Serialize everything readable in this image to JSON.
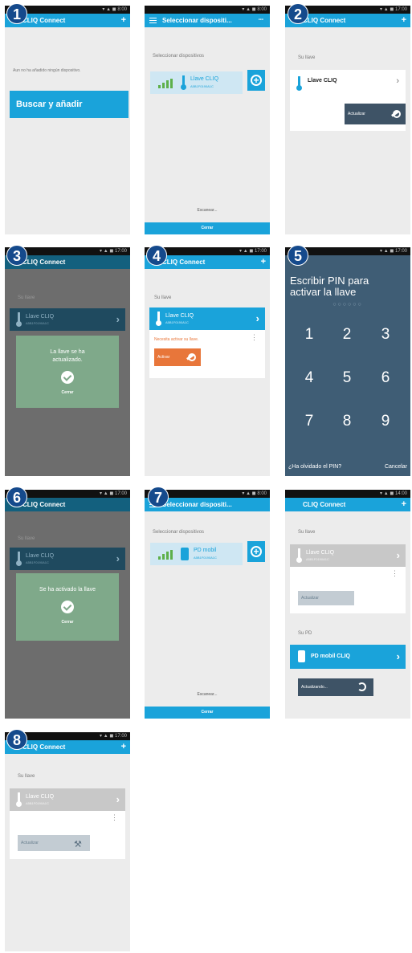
{
  "badges": [
    "1",
    "2",
    "3",
    "4",
    "5",
    "6",
    "7",
    "8"
  ],
  "colors": {
    "accent": "#1aa3da",
    "badge": "#154a8c",
    "dialog": "#7fa98a",
    "orange": "#e8763a",
    "pin_bg": "#3f5d75"
  },
  "app_title": "CLIQ Connect",
  "select_title": "Seleccionar dispositi...",
  "select_subtitle": "Seleccionar dispositivos",
  "add_prompt": "Aun no ha añadido ningún dispositivo.",
  "search_add": "Buscar y añadir",
  "device_key_name": "Llave CLIQ",
  "device_key_id": "A5B1F0190A1C",
  "scanning": "Escanear...",
  "close_short": "Cerrar",
  "your_key": "Su llave",
  "key_name": "Llave CLIQ",
  "key_id": "A5B1F0190A1C",
  "update_btn": "Actualizar",
  "updated_msg": "La llave se ha actualizado.",
  "need_activate": "Necesita activar su llave.",
  "activate_btn": "Activar",
  "pin_title": "Escribir PIN para activar la llave",
  "pin_dots": "○○○○○○",
  "pin_digits": [
    "1",
    "2",
    "3",
    "4",
    "5",
    "6",
    "7",
    "8",
    "9"
  ],
  "forgot_pin": "¿Ha olvidado el PIN?",
  "cancel": "Cancelar",
  "activated_msg": "Se ha activado la llave",
  "pd_name": "PD mobil",
  "pd_id": "A5B1F0190A1C",
  "pd_section": "Su PD",
  "pd_full_name": "PD mobil CLIQ",
  "updating": "Actualizando..."
}
